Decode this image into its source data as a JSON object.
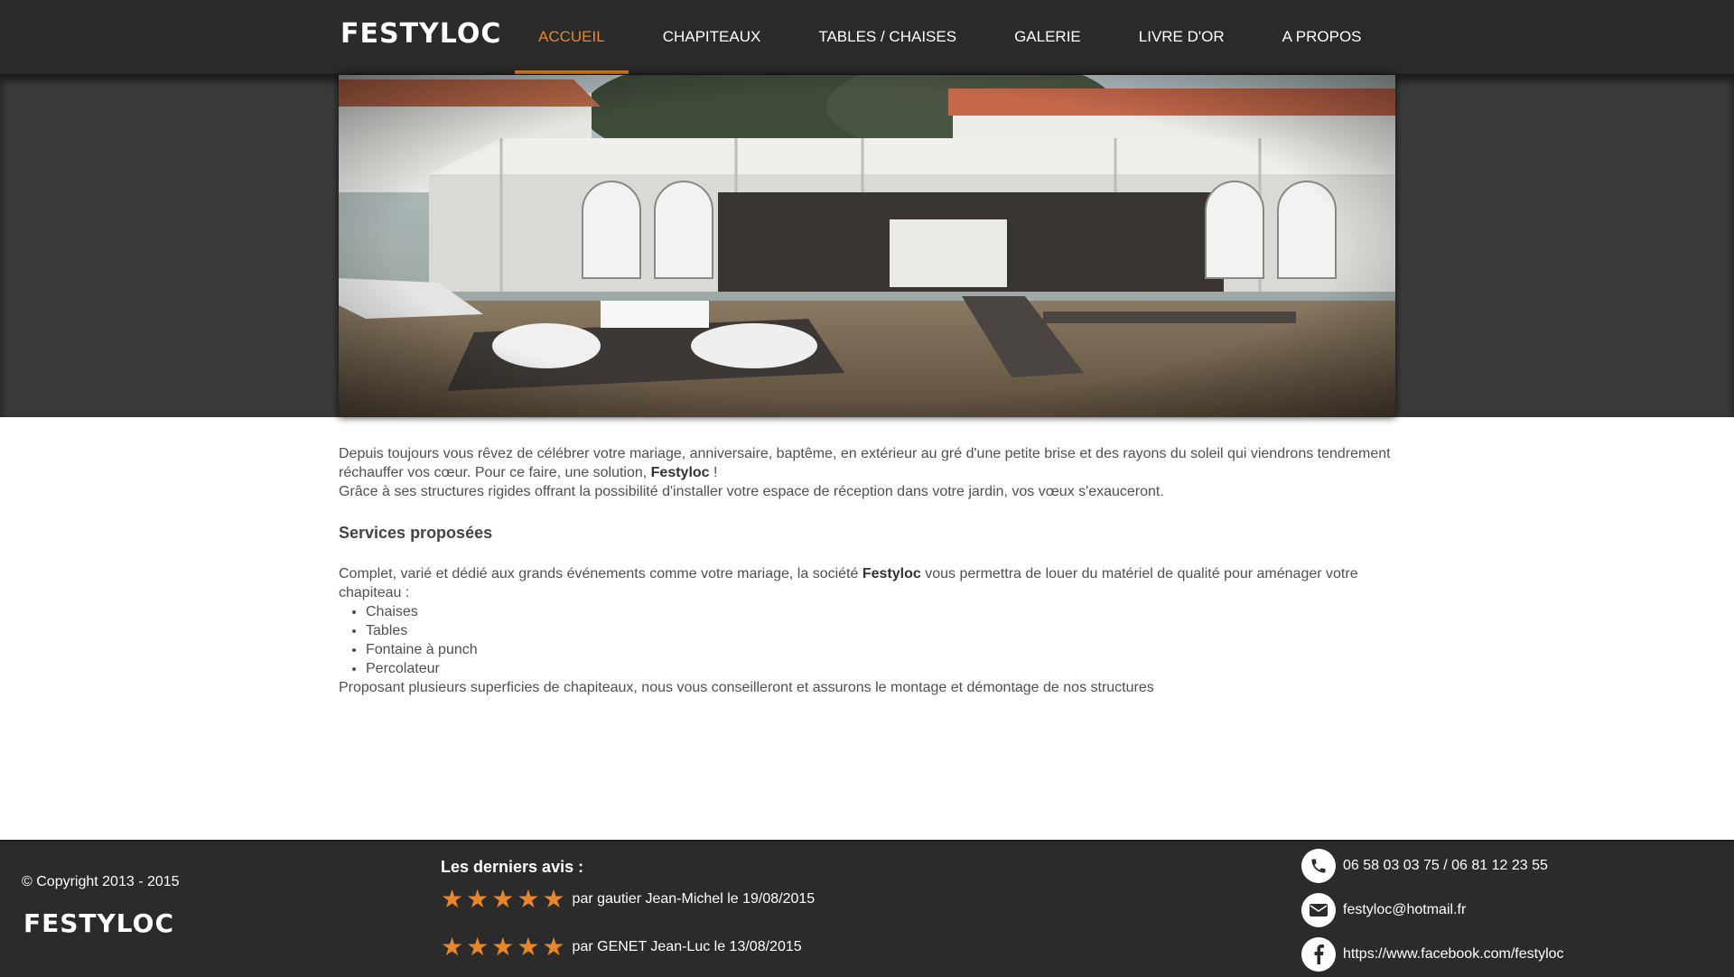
{
  "header": {
    "logo": "FESTYLOC",
    "nav": [
      {
        "label": "ACCUEIL",
        "active": true
      },
      {
        "label": "CHAPITEAUX",
        "active": false
      },
      {
        "label": "TABLES / CHAISES",
        "active": false
      },
      {
        "label": "GALERIE",
        "active": false
      },
      {
        "label": "LIVRE D'OR",
        "active": false
      },
      {
        "label": "A PROPOS",
        "active": false
      }
    ]
  },
  "colors": {
    "accent": "#e8862a",
    "header_bg": "#2a2a2a",
    "footer_bg": "#2b2b2b"
  },
  "content": {
    "intro_part1": "Depuis toujours vous rêvez de célébrer votre mariage, anniversaire, baptême, en extérieur au gré d'une petite brise et des rayons du soleil qui viendrons tendrement réchauffer vos cœur. Pour ce faire, une solution, ",
    "brand": "Festyloc",
    "intro_part2": " !",
    "intro_line2": "Grâce à ses structures rigides offrant la possibilité d'installer votre espace de réception dans votre jardin, vos vœux s'exauceront.",
    "services_heading": "Services proposées",
    "services_part1": "Complet, varié et dédié aux grands événements comme votre mariage, la société ",
    "services_part2": " vous permettra de louer du matériel de qualité pour aménager votre chapiteau :",
    "services": [
      "Chaises",
      "Tables",
      "Fontaine à punch",
      "Percolateur"
    ],
    "closing": "Proposant plusieurs superficies de chapiteaux, nous vous conseilleront et assurons le montage et démontage de nos structures"
  },
  "footer": {
    "copyright": "© Copyright 2013 - 2015",
    "logo": "FESTYLOC",
    "reviews_title": "Les derniers avis :",
    "reviews": [
      {
        "stars": 5,
        "text": "par gautier Jean-Michel le 19/08/2015"
      },
      {
        "stars": 5,
        "text": "par GENET Jean-Luc le 13/08/2015"
      }
    ],
    "contacts": [
      {
        "icon": "phone-icon",
        "text": "06 58 03 03 75 / 06 81 12 23 55"
      },
      {
        "icon": "mail-icon",
        "text": "festyloc@hotmail.fr"
      },
      {
        "icon": "facebook-icon",
        "text": "https://www.facebook.com/festyloc"
      }
    ]
  }
}
